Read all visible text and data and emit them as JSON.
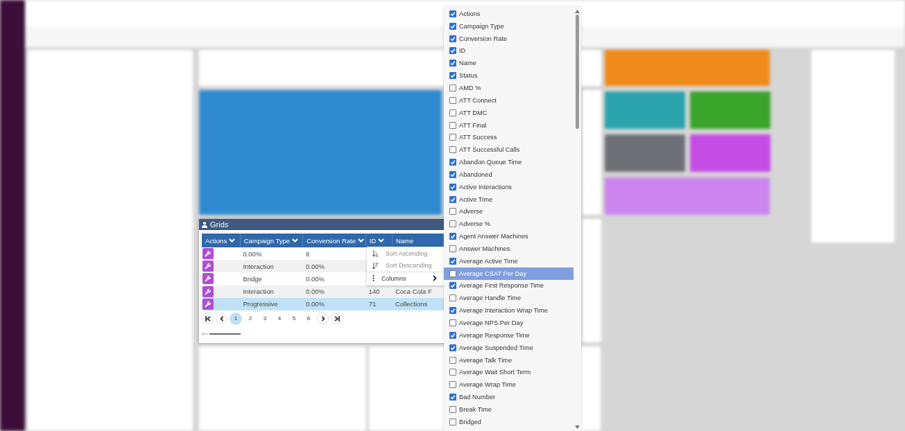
{
  "grid_panel": {
    "title": "Grids",
    "columns": [
      {
        "label": "Actions"
      },
      {
        "label": "Campaign Type"
      },
      {
        "label": "Conversion Rate"
      },
      {
        "label": "ID"
      },
      {
        "label": "Name"
      }
    ],
    "rows": [
      {
        "campaign_type": "0.00%",
        "conversion_rate": "8",
        "selected": false
      },
      {
        "campaign_type": "Interaction",
        "conversion_rate": "0.00%",
        "selected": false
      },
      {
        "campaign_type": "Bridge",
        "conversion_rate": "0.00%",
        "selected": false
      },
      {
        "campaign_type": "Interaction",
        "conversion_rate": "0.00%",
        "id": "140",
        "name": "Coca Cola F",
        "selected": false
      },
      {
        "campaign_type": "Progressive",
        "conversion_rate": "0.00%",
        "id": "71",
        "name": "Collections",
        "selected": true
      }
    ],
    "pagination": {
      "pages": [
        {
          "label": "1",
          "selected": true
        },
        {
          "label": "2",
          "selected": false
        },
        {
          "label": "3",
          "selected": false
        },
        {
          "label": "4",
          "selected": false
        },
        {
          "label": "5",
          "selected": false
        },
        {
          "label": "6",
          "selected": false
        }
      ]
    },
    "column_menu": [
      {
        "kind": "sort",
        "label": "Sort Ascending",
        "disabled": true
      },
      {
        "kind": "sort",
        "label": "Sort Descending",
        "disabled": true
      },
      {
        "kind": "submenu",
        "label": "Columns",
        "disabled": false
      }
    ]
  },
  "column_chooser": [
    {
      "label": "Actions",
      "checked": true,
      "selected": false
    },
    {
      "label": "Campaign Type",
      "checked": true,
      "selected": false
    },
    {
      "label": "Conversion Rate",
      "checked": true,
      "selected": false
    },
    {
      "label": "ID",
      "checked": true,
      "selected": false
    },
    {
      "label": "Name",
      "checked": true,
      "selected": false
    },
    {
      "label": "Status",
      "checked": true,
      "selected": false
    },
    {
      "label": "AMD %",
      "checked": false,
      "selected": false
    },
    {
      "label": "ATT Connect",
      "checked": false,
      "selected": false
    },
    {
      "label": "ATT DMC",
      "checked": false,
      "selected": false
    },
    {
      "label": "ATT Final",
      "checked": false,
      "selected": false
    },
    {
      "label": "ATT Success",
      "checked": false,
      "selected": false
    },
    {
      "label": "ATT Successful Calls",
      "checked": false,
      "selected": false
    },
    {
      "label": "Abandon Queue Time",
      "checked": true,
      "selected": false
    },
    {
      "label": "Abandoned",
      "checked": true,
      "selected": false
    },
    {
      "label": "Active Interactions",
      "checked": true,
      "selected": false
    },
    {
      "label": "Active Time",
      "checked": true,
      "selected": false
    },
    {
      "label": "Adverse",
      "checked": false,
      "selected": false
    },
    {
      "label": "Adverse %",
      "checked": false,
      "selected": false
    },
    {
      "label": "Agent Answer Machines",
      "checked": true,
      "selected": false
    },
    {
      "label": "Answer Machines",
      "checked": false,
      "selected": false
    },
    {
      "label": "Average Active Time",
      "checked": true,
      "selected": false
    },
    {
      "label": "Average CSAT Per Day",
      "checked": false,
      "selected": true
    },
    {
      "label": "Average First Response Time",
      "checked": true,
      "selected": false
    },
    {
      "label": "Average Handle Time",
      "checked": false,
      "selected": false
    },
    {
      "label": "Average Interaction Wrap Time",
      "checked": true,
      "selected": false
    },
    {
      "label": "Average NPS Per Day",
      "checked": false,
      "selected": false
    },
    {
      "label": "Average Response Time",
      "checked": true,
      "selected": false
    },
    {
      "label": "Average Suspended Time",
      "checked": true,
      "selected": false
    },
    {
      "label": "Average Talk Time",
      "checked": false,
      "selected": false
    },
    {
      "label": "Average Wait Short Term",
      "checked": false,
      "selected": false
    },
    {
      "label": "Average Wrap Time",
      "checked": false,
      "selected": false
    },
    {
      "label": "Bad Number",
      "checked": true,
      "selected": false
    },
    {
      "label": "Break Time",
      "checked": false,
      "selected": false
    },
    {
      "label": "Bridged",
      "checked": false,
      "selected": false
    }
  ]
}
